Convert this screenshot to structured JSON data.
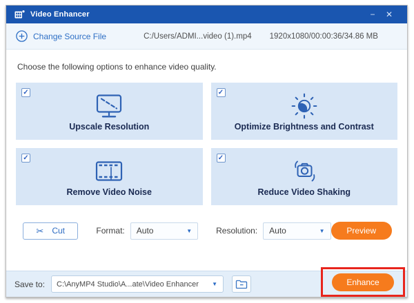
{
  "window": {
    "title": "Video Enhancer"
  },
  "icons": {
    "minimize": "−",
    "close": "✕",
    "checkmark": "✓",
    "dropdown_arrow": "▼",
    "scissors": "✂"
  },
  "header": {
    "change_source_label": "Change Source File",
    "file_path": "C:/Users/ADMI...video (1).mp4",
    "file_info": "1920x1080/00:00:36/34.86 MB"
  },
  "main": {
    "prompt": "Choose the following options to enhance video quality.",
    "options": [
      {
        "label": "Upscale Resolution",
        "checked": true,
        "icon": "monitor-upscale-icon"
      },
      {
        "label": "Optimize Brightness and Contrast",
        "checked": true,
        "icon": "brightness-sun-icon"
      },
      {
        "label": "Remove Video Noise",
        "checked": true,
        "icon": "film-strip-icon"
      },
      {
        "label": "Reduce Video Shaking",
        "checked": true,
        "icon": "camera-shake-icon"
      }
    ]
  },
  "toolbar": {
    "cut_label": "Cut",
    "format_label": "Format:",
    "format_value": "Auto",
    "resolution_label": "Resolution:",
    "resolution_value": "Auto",
    "preview_label": "Preview"
  },
  "footer": {
    "save_to_label": "Save to:",
    "save_path": "C:\\AnyMP4 Studio\\A...ate\\Video Enhancer",
    "enhance_label": "Enhance"
  },
  "colors": {
    "titlebar_blue": "#1a56b0",
    "link_blue": "#2e6fc5",
    "icon_blue": "#2e62b4",
    "card_bg": "#d8e6f6",
    "card_label_navy": "#1a2a52",
    "accent_orange": "#f67b1d",
    "annotation_red": "#e8251d",
    "footer_bg": "#e3eef9"
  }
}
